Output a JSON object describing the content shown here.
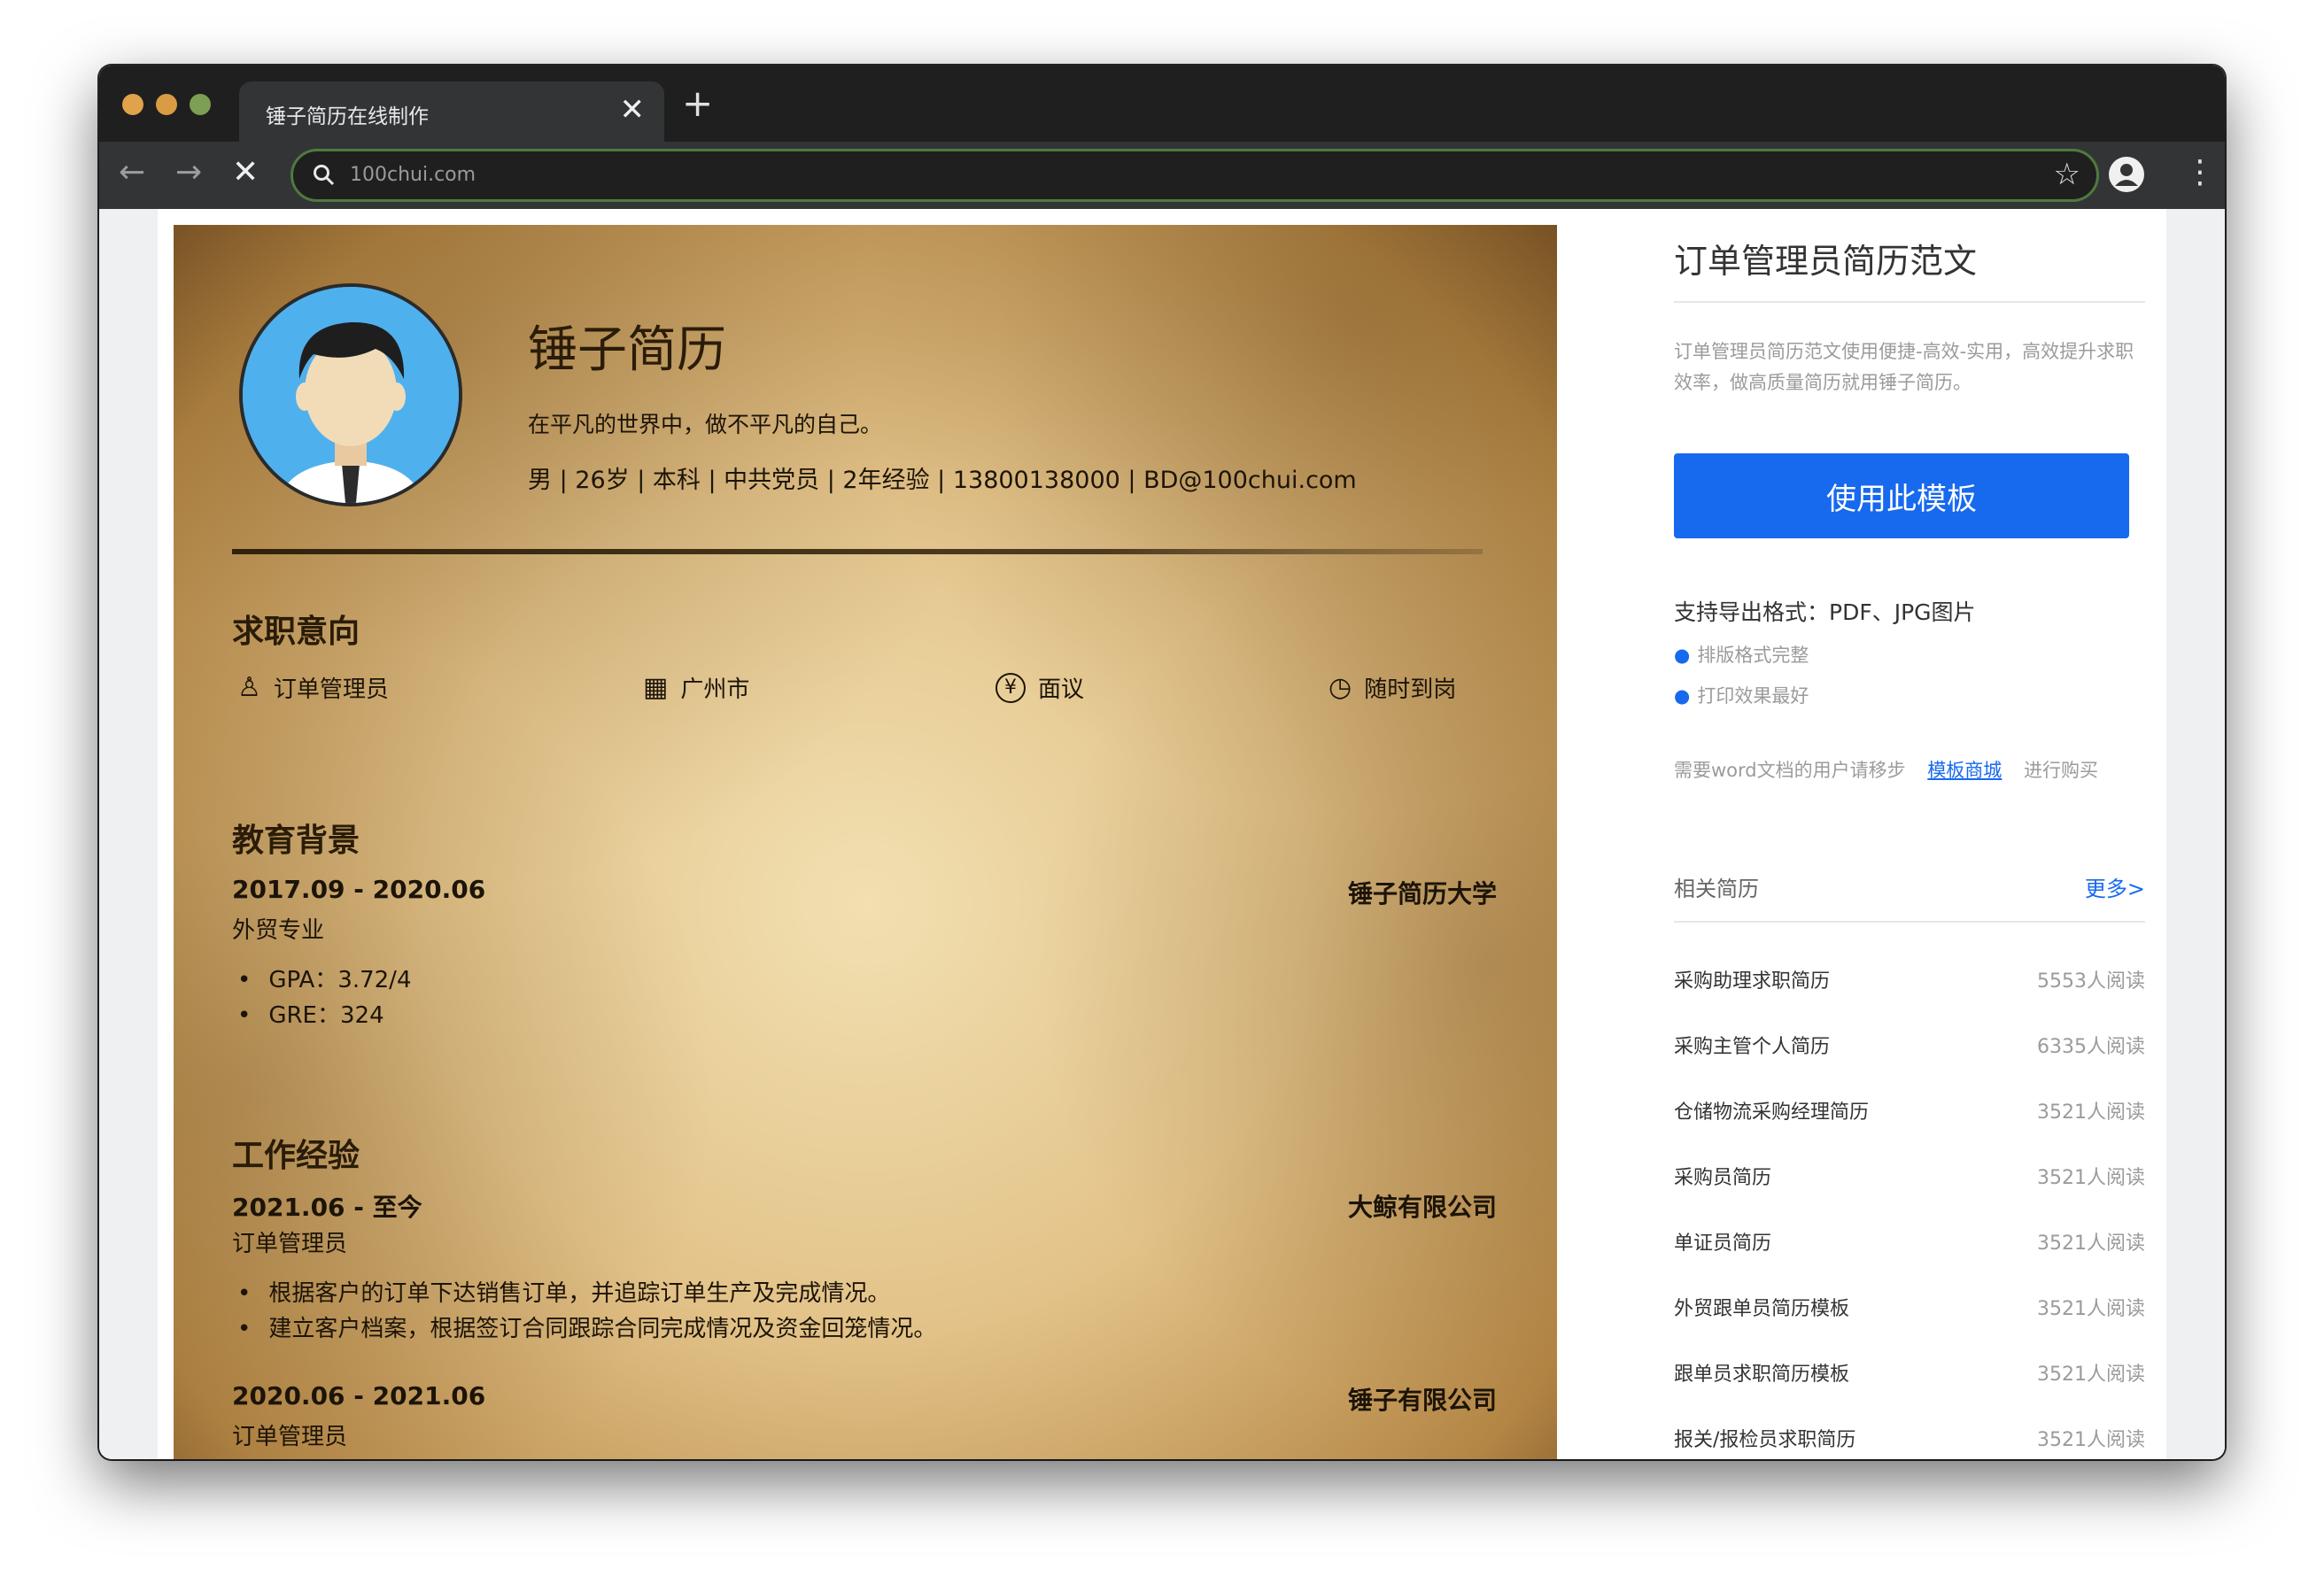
{
  "browser": {
    "tab_title": "锤子简历在线制作",
    "tab_close": "✕",
    "new_tab": "+",
    "url": "100chui.com",
    "back": "←",
    "forward": "→",
    "stop": "✕",
    "star": "☆",
    "menu": "⋮",
    "traffic_colors": [
      "#e0a24a",
      "#d99b43",
      "#7d9f53"
    ]
  },
  "resume": {
    "name": "锤子简历",
    "motto": "在平凡的世界中，做不平凡的自己。",
    "info": "男 | 26岁 | 本科 | 中共党员 | 2年经验 | 13800138000 | BD@100chui.com",
    "intent_title": "求职意向",
    "intent": [
      {
        "icon": "tie-icon",
        "glyph": "♙",
        "label": "订单管理员"
      },
      {
        "icon": "building-icon",
        "glyph": "▦",
        "label": "广州市"
      },
      {
        "icon": "yen-icon",
        "glyph": "¥",
        "label": "面议"
      },
      {
        "icon": "clock-icon",
        "glyph": "◷",
        "label": "随时到岗"
      }
    ],
    "edu_title": "教育背景",
    "edu": {
      "date": "2017.09 - 2020.06",
      "school": "锤子简历大学",
      "major": "外贸专业",
      "bullets": [
        "GPA：3.72/4",
        "GRE：324"
      ]
    },
    "work_title": "工作经验",
    "work": [
      {
        "date": "2021.06 - 至今",
        "company": "大鲸有限公司",
        "role": "订单管理员",
        "bullets": [
          "根据客户的订单下达销售订单，并追踪订单生产及完成情况。",
          "建立客户档案，根据签订合同跟踪合同完成情况及资金回笼情况。"
        ]
      },
      {
        "date": "2020.06 - 2021.06",
        "company": "锤子有限公司",
        "role": "订单管理员"
      }
    ]
  },
  "sidebar": {
    "title": "订单管理员简历范文",
    "desc": "订单管理员简历范文使用便捷-高效-实用，高效提升求职效率，做高质量简历就用锤子简历。",
    "use_button": "使用此模板",
    "formats": "支持导出格式：PDF、JPG图片",
    "points": [
      "排版格式完整",
      "打印效果最好"
    ],
    "word_note": "需要word文档的用户请移步",
    "word_link": "模板商城",
    "word_suffix": "进行购买",
    "related_title": "相关简历",
    "related_more": "更多>",
    "related": [
      {
        "name": "采购助理求职简历",
        "count": "5553人阅读"
      },
      {
        "name": "采购主管个人简历",
        "count": "6335人阅读"
      },
      {
        "name": "仓储物流采购经理简历",
        "count": "3521人阅读"
      },
      {
        "name": "采购员简历",
        "count": "3521人阅读"
      },
      {
        "name": "单证员简历",
        "count": "3521人阅读"
      },
      {
        "name": "外贸跟单员简历模板",
        "count": "3521人阅读"
      },
      {
        "name": "跟单员求职简历模板",
        "count": "3521人阅读"
      },
      {
        "name": "报关/报检员求职简历",
        "count": "3521人阅读"
      }
    ]
  }
}
